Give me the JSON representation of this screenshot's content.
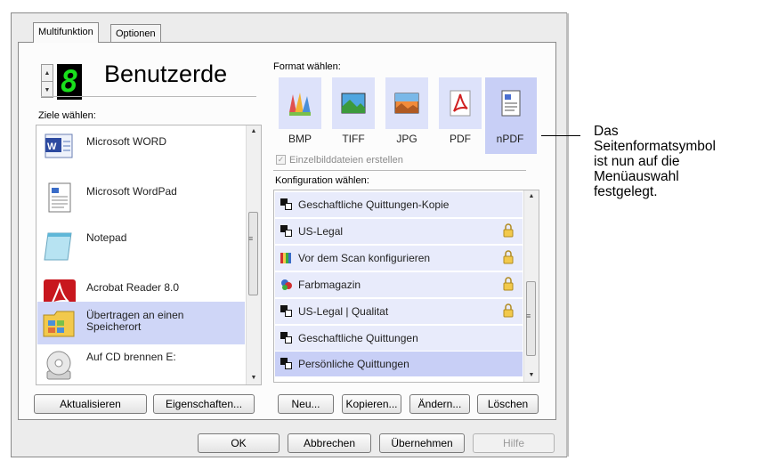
{
  "tabs": [
    "Multifunktion",
    "Optionen"
  ],
  "profile": {
    "number": "8",
    "name": "Benutzerde"
  },
  "targets": {
    "label": "Ziele wählen:",
    "items": [
      {
        "label": "Microsoft WORD",
        "icon": "word-icon"
      },
      {
        "label": "Microsoft WordPad",
        "icon": "wordpad-icon"
      },
      {
        "label": "Notepad",
        "icon": "notepad-icon"
      },
      {
        "label": "Acrobat Reader 8.0",
        "icon": "acrobat-icon"
      },
      {
        "label": "Übertragen an einen Speicherort",
        "icon": "folder-icon",
        "selected": true
      },
      {
        "label": "Auf CD brennen  E:",
        "icon": "cd-icon"
      }
    ]
  },
  "format": {
    "label": "Format wählen:",
    "items": [
      {
        "label": "BMP",
        "icon": "bmp-icon"
      },
      {
        "label": "TIFF",
        "icon": "tiff-icon"
      },
      {
        "label": "JPG",
        "icon": "jpg-icon"
      },
      {
        "label": "PDF",
        "icon": "pdf-icon"
      },
      {
        "label": "nPDF",
        "icon": "npdf-icon",
        "selected": true
      }
    ],
    "single_files_label": "Einzelbilddateien erstellen",
    "single_files_checked": true
  },
  "config": {
    "label": "Konfiguration wählen:",
    "items": [
      {
        "label": "Geschaftliche Quittungen-Kopie",
        "locked": false
      },
      {
        "label": "US-Legal",
        "locked": true
      },
      {
        "label": "Vor dem Scan konfigurieren",
        "locked": true
      },
      {
        "label": "Farbmagazin",
        "locked": true
      },
      {
        "label": "US-Legal | Qualitat",
        "locked": true
      },
      {
        "label": "Geschaftliche Quittungen",
        "locked": false
      },
      {
        "label": "Persönliche Quittungen",
        "locked": false,
        "selected": true
      }
    ]
  },
  "buttons": {
    "refresh": "Aktualisieren",
    "properties": "Eigenschaften...",
    "new": "Neu...",
    "copy": "Kopieren...",
    "edit": "Ändern...",
    "delete": "Löschen",
    "ok": "OK",
    "cancel": "Abbrechen",
    "apply": "Übernehmen",
    "help": "Hilfe"
  },
  "callout": [
    "Das",
    "Seitenformatsymbol",
    "ist nun auf die",
    "Menüauswahl",
    "festgelegt."
  ],
  "colors": {
    "selection": "#c8cff6",
    "row": "#e8ebfb",
    "digit": "#19e01c"
  }
}
